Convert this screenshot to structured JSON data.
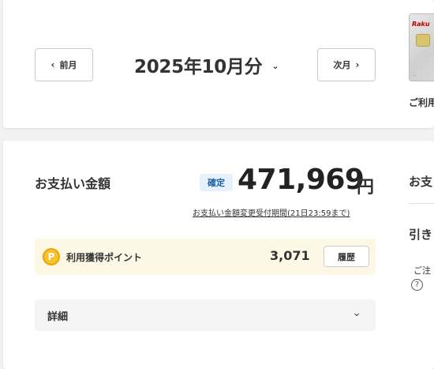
{
  "header": {
    "prev_label": "前月",
    "next_label": "次月",
    "month_title": "2025年10月分",
    "card_logo": "Raku",
    "usage_label": "ご利用"
  },
  "payment": {
    "label": "お支払い金額",
    "status_badge": "確定",
    "amount": "471,969",
    "currency": "円",
    "change_link": "お支払い金額変更受付期間(21日23:59まで)"
  },
  "points": {
    "icon_letter": "P",
    "label": "利用獲得ポイント",
    "value": "3,071",
    "history_button": "履歴"
  },
  "details": {
    "label": "詳細"
  },
  "right_column": {
    "label_1": "お支",
    "label_2": "引き",
    "note": "ご注",
    "help_symbol": "?"
  },
  "colors": {
    "background": "#f2f2f2",
    "badge_bg": "#e7f1fb",
    "badge_text": "#1d5fa3",
    "points_bg": "#fdf8e5",
    "points_icon": "#f7c230",
    "brand_red": "#bf0000"
  }
}
